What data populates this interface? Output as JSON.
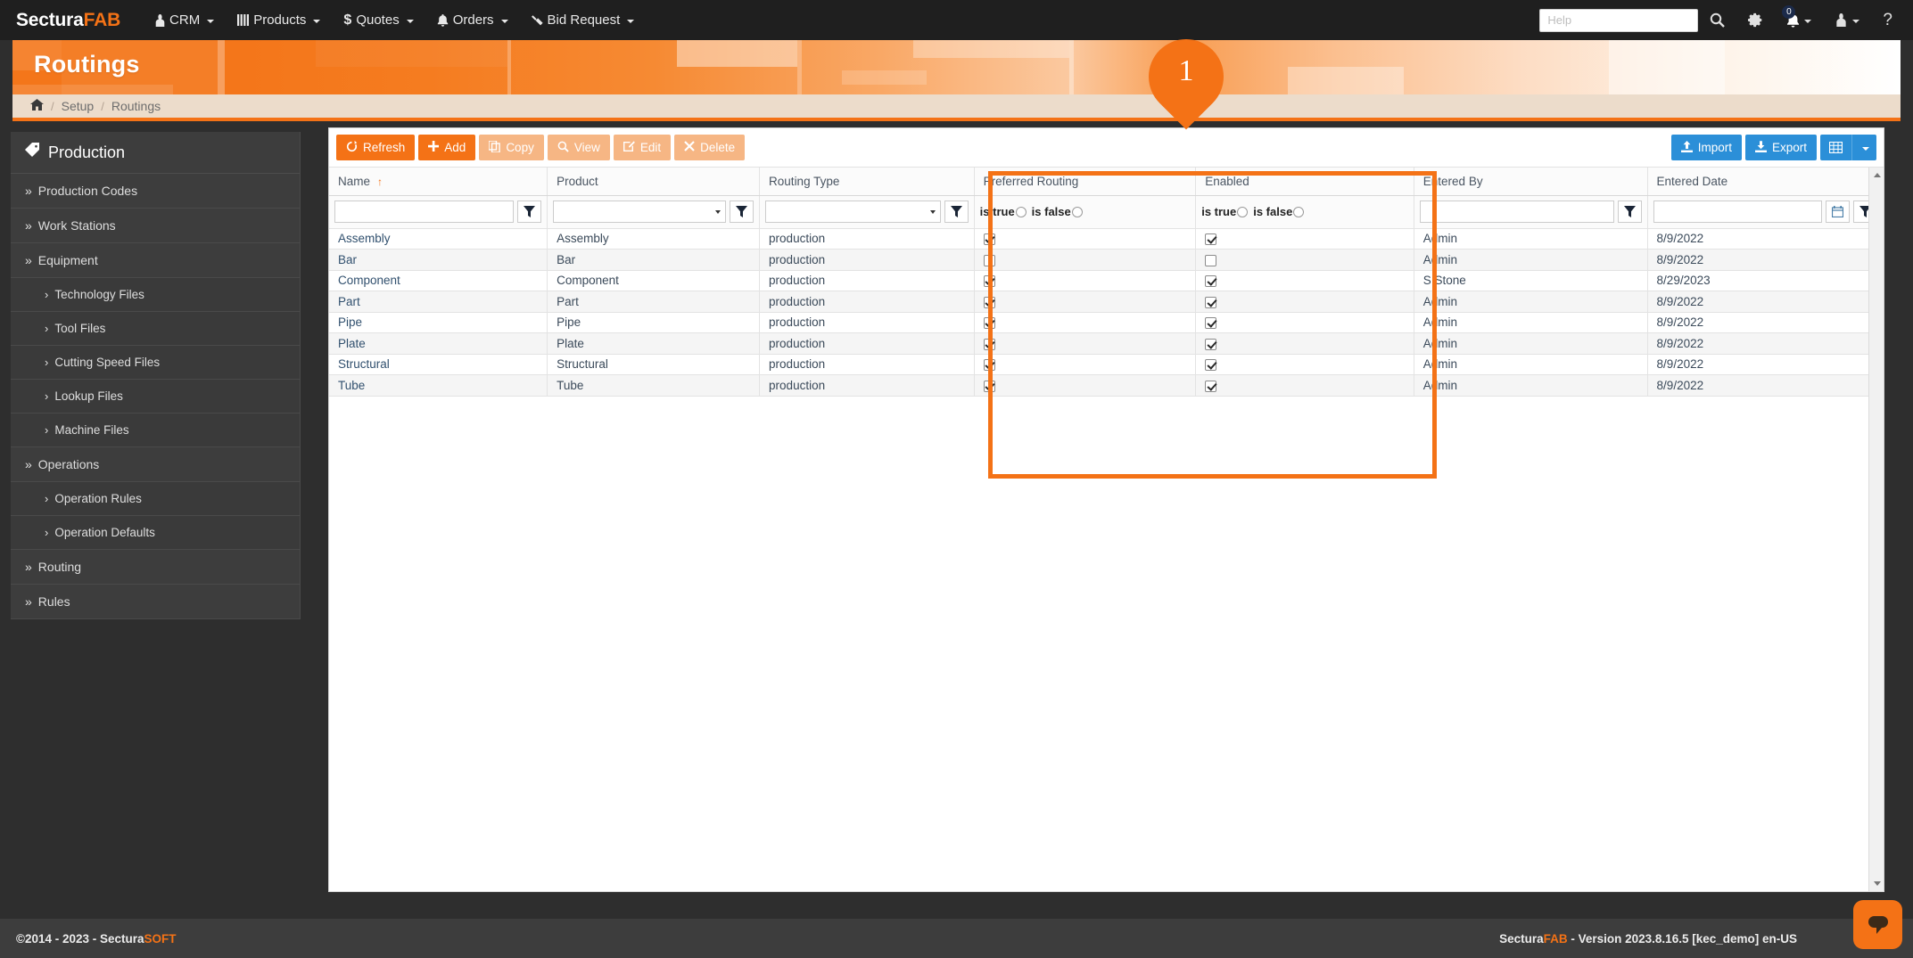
{
  "navbar": {
    "brand_prefix": "Sectura",
    "brand_suffix": "FAB",
    "menu": [
      {
        "label": "CRM",
        "icon": "person-icon"
      },
      {
        "label": "Products",
        "icon": "bars-icon"
      },
      {
        "label": "Quotes",
        "icon": "dollar-icon"
      },
      {
        "label": "Orders",
        "icon": "bell-icon"
      },
      {
        "label": "Bid Request",
        "icon": "hammer-icon"
      }
    ],
    "search_placeholder": "Help",
    "search_value": "",
    "notification_count": "0",
    "icons": {
      "search": "search-icon",
      "gear": "gear-icon",
      "bell": "bell-icon",
      "user": "user-icon",
      "help": "?"
    }
  },
  "header": {
    "title": "Routings"
  },
  "breadcrumb": {
    "home": "⌂",
    "items": [
      "Setup",
      "Routings"
    ],
    "separator": "/"
  },
  "sidebar": {
    "title": "Production",
    "title_icon": "tag-icon",
    "items": [
      {
        "label": "Production Codes",
        "level": 1,
        "chev": "»"
      },
      {
        "label": "Work Stations",
        "level": 1,
        "chev": "»"
      },
      {
        "label": "Equipment",
        "level": 1,
        "chev": "»"
      },
      {
        "label": "Technology Files",
        "level": 2,
        "chev": "›"
      },
      {
        "label": "Tool Files",
        "level": 2,
        "chev": "›"
      },
      {
        "label": "Cutting Speed Files",
        "level": 2,
        "chev": "›"
      },
      {
        "label": "Lookup Files",
        "level": 2,
        "chev": "›"
      },
      {
        "label": "Machine Files",
        "level": 2,
        "chev": "›"
      },
      {
        "label": "Operations",
        "level": 1,
        "chev": "»"
      },
      {
        "label": "Operation Rules",
        "level": 2,
        "chev": "›"
      },
      {
        "label": "Operation Defaults",
        "level": 2,
        "chev": "›"
      },
      {
        "label": "Routing",
        "level": 1,
        "chev": "»"
      },
      {
        "label": "Rules",
        "level": 1,
        "chev": "»"
      }
    ]
  },
  "toolbar": {
    "refresh_label": "Refresh",
    "add_label": "Add",
    "copy_label": "Copy",
    "view_label": "View",
    "edit_label": "Edit",
    "delete_label": "Delete",
    "import_label": "Import",
    "export_label": "Export",
    "columns_icon": "grid-icon"
  },
  "grid": {
    "columns": [
      {
        "label": "Name",
        "sort": "↑",
        "filter": "text"
      },
      {
        "label": "Product",
        "filter": "select"
      },
      {
        "label": "Routing Type",
        "filter": "select"
      },
      {
        "label": "Preferred Routing",
        "filter": "bool"
      },
      {
        "label": "Enabled",
        "filter": "bool"
      },
      {
        "label": "Entered By",
        "filter": "text"
      },
      {
        "label": "Entered Date",
        "filter": "date"
      }
    ],
    "bool_filter": {
      "true_label": "is true",
      "false_label": "is false"
    },
    "rows": [
      {
        "name": "Assembly",
        "product": "Assembly",
        "routing_type": "production",
        "preferred": true,
        "enabled": true,
        "entered_by": "Admin",
        "entered_date": "8/9/2022"
      },
      {
        "name": "Bar",
        "product": "Bar",
        "routing_type": "production",
        "preferred": false,
        "enabled": false,
        "entered_by": "Admin",
        "entered_date": "8/9/2022"
      },
      {
        "name": "Component",
        "product": "Component",
        "routing_type": "production",
        "preferred": true,
        "enabled": true,
        "entered_by": "S Stone",
        "entered_date": "8/29/2023"
      },
      {
        "name": "Part",
        "product": "Part",
        "routing_type": "production",
        "preferred": true,
        "enabled": true,
        "entered_by": "Admin",
        "entered_date": "8/9/2022"
      },
      {
        "name": "Pipe",
        "product": "Pipe",
        "routing_type": "production",
        "preferred": true,
        "enabled": true,
        "entered_by": "Admin",
        "entered_date": "8/9/2022"
      },
      {
        "name": "Plate",
        "product": "Plate",
        "routing_type": "production",
        "preferred": true,
        "enabled": true,
        "entered_by": "Admin",
        "entered_date": "8/9/2022"
      },
      {
        "name": "Structural",
        "product": "Structural",
        "routing_type": "production",
        "preferred": true,
        "enabled": true,
        "entered_by": "Admin",
        "entered_date": "8/9/2022"
      },
      {
        "name": "Tube",
        "product": "Tube",
        "routing_type": "production",
        "preferred": true,
        "enabled": true,
        "entered_by": "Admin",
        "entered_date": "8/9/2022"
      }
    ]
  },
  "annotation": {
    "pin_number": "1",
    "highlight_color": "#f47216"
  },
  "footer": {
    "copyright_pre": "©2014 - 2023 - Sectura",
    "copyright_brand": "SOFT",
    "version_pre": "Sectura",
    "version_brand": "FAB",
    "version_text": " - Version 2023.8.16.5 [kec_demo] en-US",
    "chat_icon": "chat-bubble-icon"
  },
  "colors": {
    "accent": "#f47216",
    "blue": "#2b8fd8",
    "dark": "#3d3d3d",
    "navbar": "#1f1f1f"
  }
}
